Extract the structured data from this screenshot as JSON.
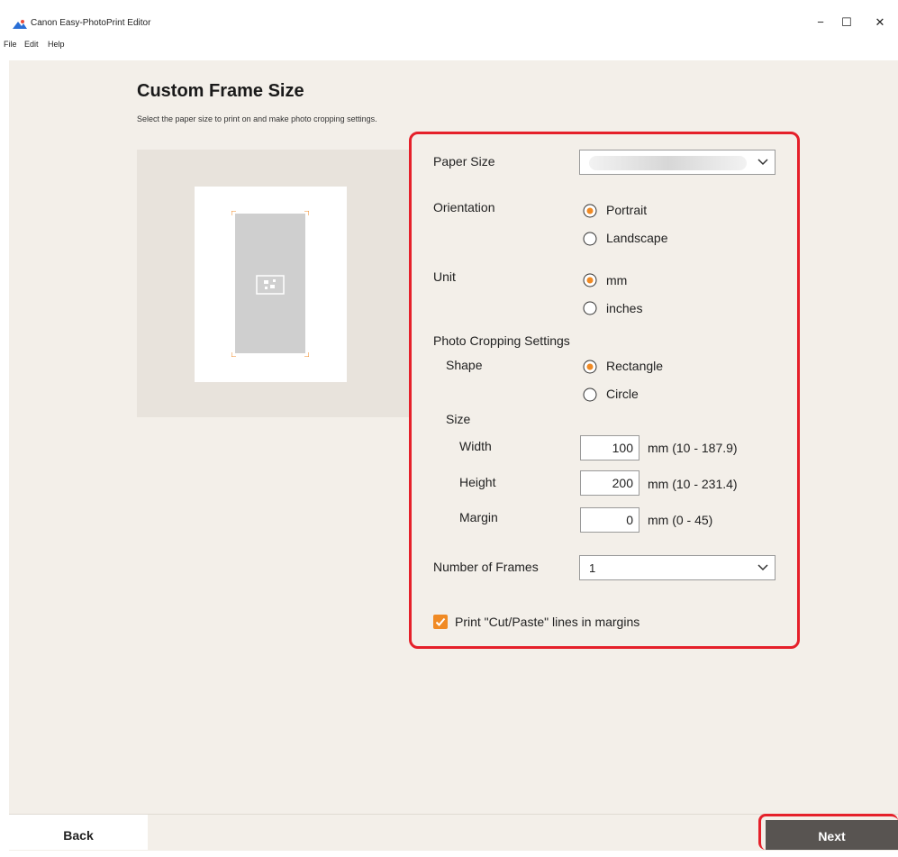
{
  "window": {
    "title": "Canon Easy-PhotoPrint Editor",
    "controls": {
      "minimize": "−",
      "maximize": "☐",
      "close": "✕"
    }
  },
  "menu": {
    "items": [
      "File",
      "Edit",
      "Help"
    ]
  },
  "page": {
    "title": "Custom Frame Size",
    "subtitle": "Select the paper size to print on and make photo cropping settings."
  },
  "settings": {
    "paper_size": {
      "label": "Paper Size",
      "value": ""
    },
    "orientation": {
      "label": "Orientation",
      "options": [
        "Portrait",
        "Landscape"
      ],
      "selected": "Portrait"
    },
    "unit": {
      "label": "Unit",
      "options": [
        "mm",
        "inches"
      ],
      "selected": "mm"
    },
    "cropping": {
      "label": "Photo Cropping Settings",
      "shape": {
        "label": "Shape",
        "options": [
          "Rectangle",
          "Circle"
        ],
        "selected": "Rectangle"
      },
      "size": {
        "label": "Size",
        "width": {
          "label": "Width",
          "value": "100",
          "range": "mm (10 - 187.9)"
        },
        "height": {
          "label": "Height",
          "value": "200",
          "range": "mm (10 - 231.4)"
        },
        "margin": {
          "label": "Margin",
          "value": "0",
          "range": "mm (0 - 45)"
        }
      }
    },
    "frames": {
      "label": "Number of Frames",
      "value": "1"
    },
    "cut_lines": {
      "label": "Print \"Cut/Paste\" lines in margins",
      "checked": true
    }
  },
  "footer": {
    "back": "Back",
    "next": "Next"
  },
  "colors": {
    "accent": "#f08a24",
    "highlight": "#e5202a",
    "next_button": "#585451",
    "background": "#f3efe9"
  }
}
